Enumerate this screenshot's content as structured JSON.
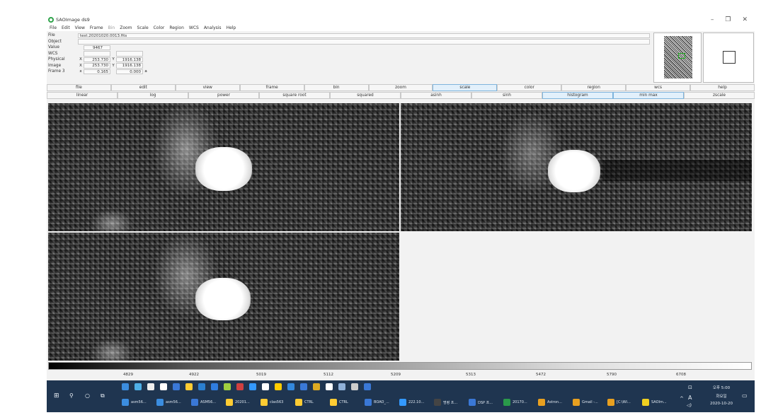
{
  "window": {
    "title": "SAOImage ds9",
    "controls": [
      "–",
      "❐",
      "✕"
    ]
  },
  "menu": [
    "File",
    "Edit",
    "View",
    "Frame",
    "Bin",
    "Zoom",
    "Scale",
    "Color",
    "Region",
    "WCS",
    "Analysis",
    "Help"
  ],
  "info": {
    "file_label": "File",
    "file_value": "test.20201020.0013.fits",
    "object_label": "Object",
    "value_label": "Value",
    "value_value": "9467",
    "wcs_label": "WCS",
    "physical_label": "Physical",
    "physical_x": "253.730",
    "physical_y": "1916.138",
    "image_label": "Image",
    "image_x": "253.730",
    "image_y": "1916.138",
    "frame_label": "Frame 3",
    "frame_zoom": "0.165",
    "frame_angle": "0.000",
    "x": "X",
    "y": "Y",
    "angle_unit": "a"
  },
  "main_buttons": [
    {
      "label": "file",
      "active": false
    },
    {
      "label": "edit",
      "active": false
    },
    {
      "label": "view",
      "active": false
    },
    {
      "label": "frame",
      "active": false
    },
    {
      "label": "bin",
      "active": false
    },
    {
      "label": "zoom",
      "active": false
    },
    {
      "label": "scale",
      "active": true
    },
    {
      "label": "color",
      "active": false
    },
    {
      "label": "region",
      "active": false
    },
    {
      "label": "wcs",
      "active": false
    },
    {
      "label": "help",
      "active": false
    }
  ],
  "scale_buttons": [
    {
      "label": "linear",
      "active": false
    },
    {
      "label": "log",
      "active": false
    },
    {
      "label": "power",
      "active": false
    },
    {
      "label": "square root",
      "active": false
    },
    {
      "label": "squared",
      "active": false
    },
    {
      "label": "asinh",
      "active": false
    },
    {
      "label": "sinh",
      "active": false
    },
    {
      "label": "histogram",
      "active": true
    },
    {
      "label": "min max",
      "active": true
    },
    {
      "label": "zscale",
      "active": false
    }
  ],
  "colorbar": {
    "ticks": [
      "4829",
      "4922",
      "5019",
      "5112",
      "5209",
      "5313",
      "5472",
      "5790",
      "6708"
    ]
  },
  "taskbar": {
    "apps": [
      "asm56...",
      "asm56...",
      "ASM56...",
      "20201...",
      "clas563",
      "CTRL",
      "CTRL",
      "BOAO_...",
      "222.10...",
      "명령 프...",
      "DSP 프...",
      "20170...",
      "Astron...",
      "Gmail -...",
      "[C:\\Wi...",
      "SAOIm..."
    ],
    "clock_time": "오후 5:00",
    "clock_day": "화요일",
    "clock_date": "2020-10-20",
    "ime": "A",
    "volume": "◁)"
  }
}
